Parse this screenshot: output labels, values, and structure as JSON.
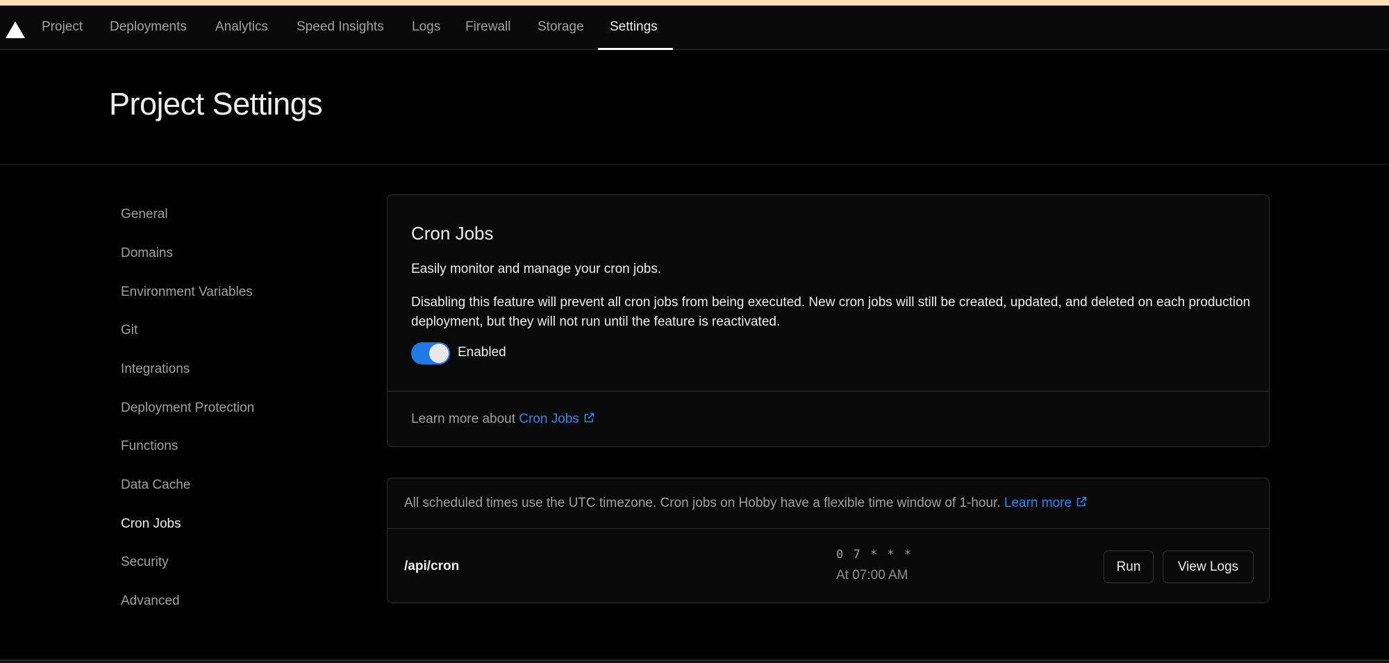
{
  "colors": {
    "accent": "#1f7ae8",
    "link": "#2b8af0",
    "top_strip": "#ffdfb6"
  },
  "nav": {
    "logo_icon": "vercel-triangle-icon",
    "tabs": [
      {
        "label": "Project"
      },
      {
        "label": "Deployments"
      },
      {
        "label": "Analytics"
      },
      {
        "label": "Speed Insights"
      },
      {
        "label": "Logs"
      },
      {
        "label": "Firewall"
      },
      {
        "label": "Storage"
      },
      {
        "label": "Settings",
        "active": true
      }
    ]
  },
  "page": {
    "title": "Project Settings"
  },
  "sidebar": {
    "items": [
      {
        "label": "General"
      },
      {
        "label": "Domains"
      },
      {
        "label": "Environment Variables"
      },
      {
        "label": "Git"
      },
      {
        "label": "Integrations"
      },
      {
        "label": "Deployment Protection"
      },
      {
        "label": "Functions"
      },
      {
        "label": "Data Cache"
      },
      {
        "label": "Cron Jobs",
        "active": true
      },
      {
        "label": "Security"
      },
      {
        "label": "Advanced"
      }
    ]
  },
  "cron_card": {
    "title": "Cron Jobs",
    "description": "Easily monitor and manage your cron jobs.",
    "paragraph": "Disabling this feature will prevent all cron jobs from being executed. New cron jobs will still be created, updated, and deleted on each production deployment, but they will not run until the feature is reactivated.",
    "toggle": {
      "enabled": true,
      "label": "Enabled"
    },
    "learn_prefix": "Learn more about ",
    "learn_link": "Cron Jobs",
    "learn_icon": "external-link-icon"
  },
  "jobs_card": {
    "info_text": "All scheduled times use the UTC timezone. Cron jobs on Hobby have a flexible time window of 1-hour. ",
    "info_link": "Learn more",
    "jobs": [
      {
        "path": "/api/cron",
        "schedule": "0 7 * * *",
        "human": "At 07:00 AM",
        "run_label": "Run",
        "logs_label": "View Logs"
      }
    ]
  }
}
